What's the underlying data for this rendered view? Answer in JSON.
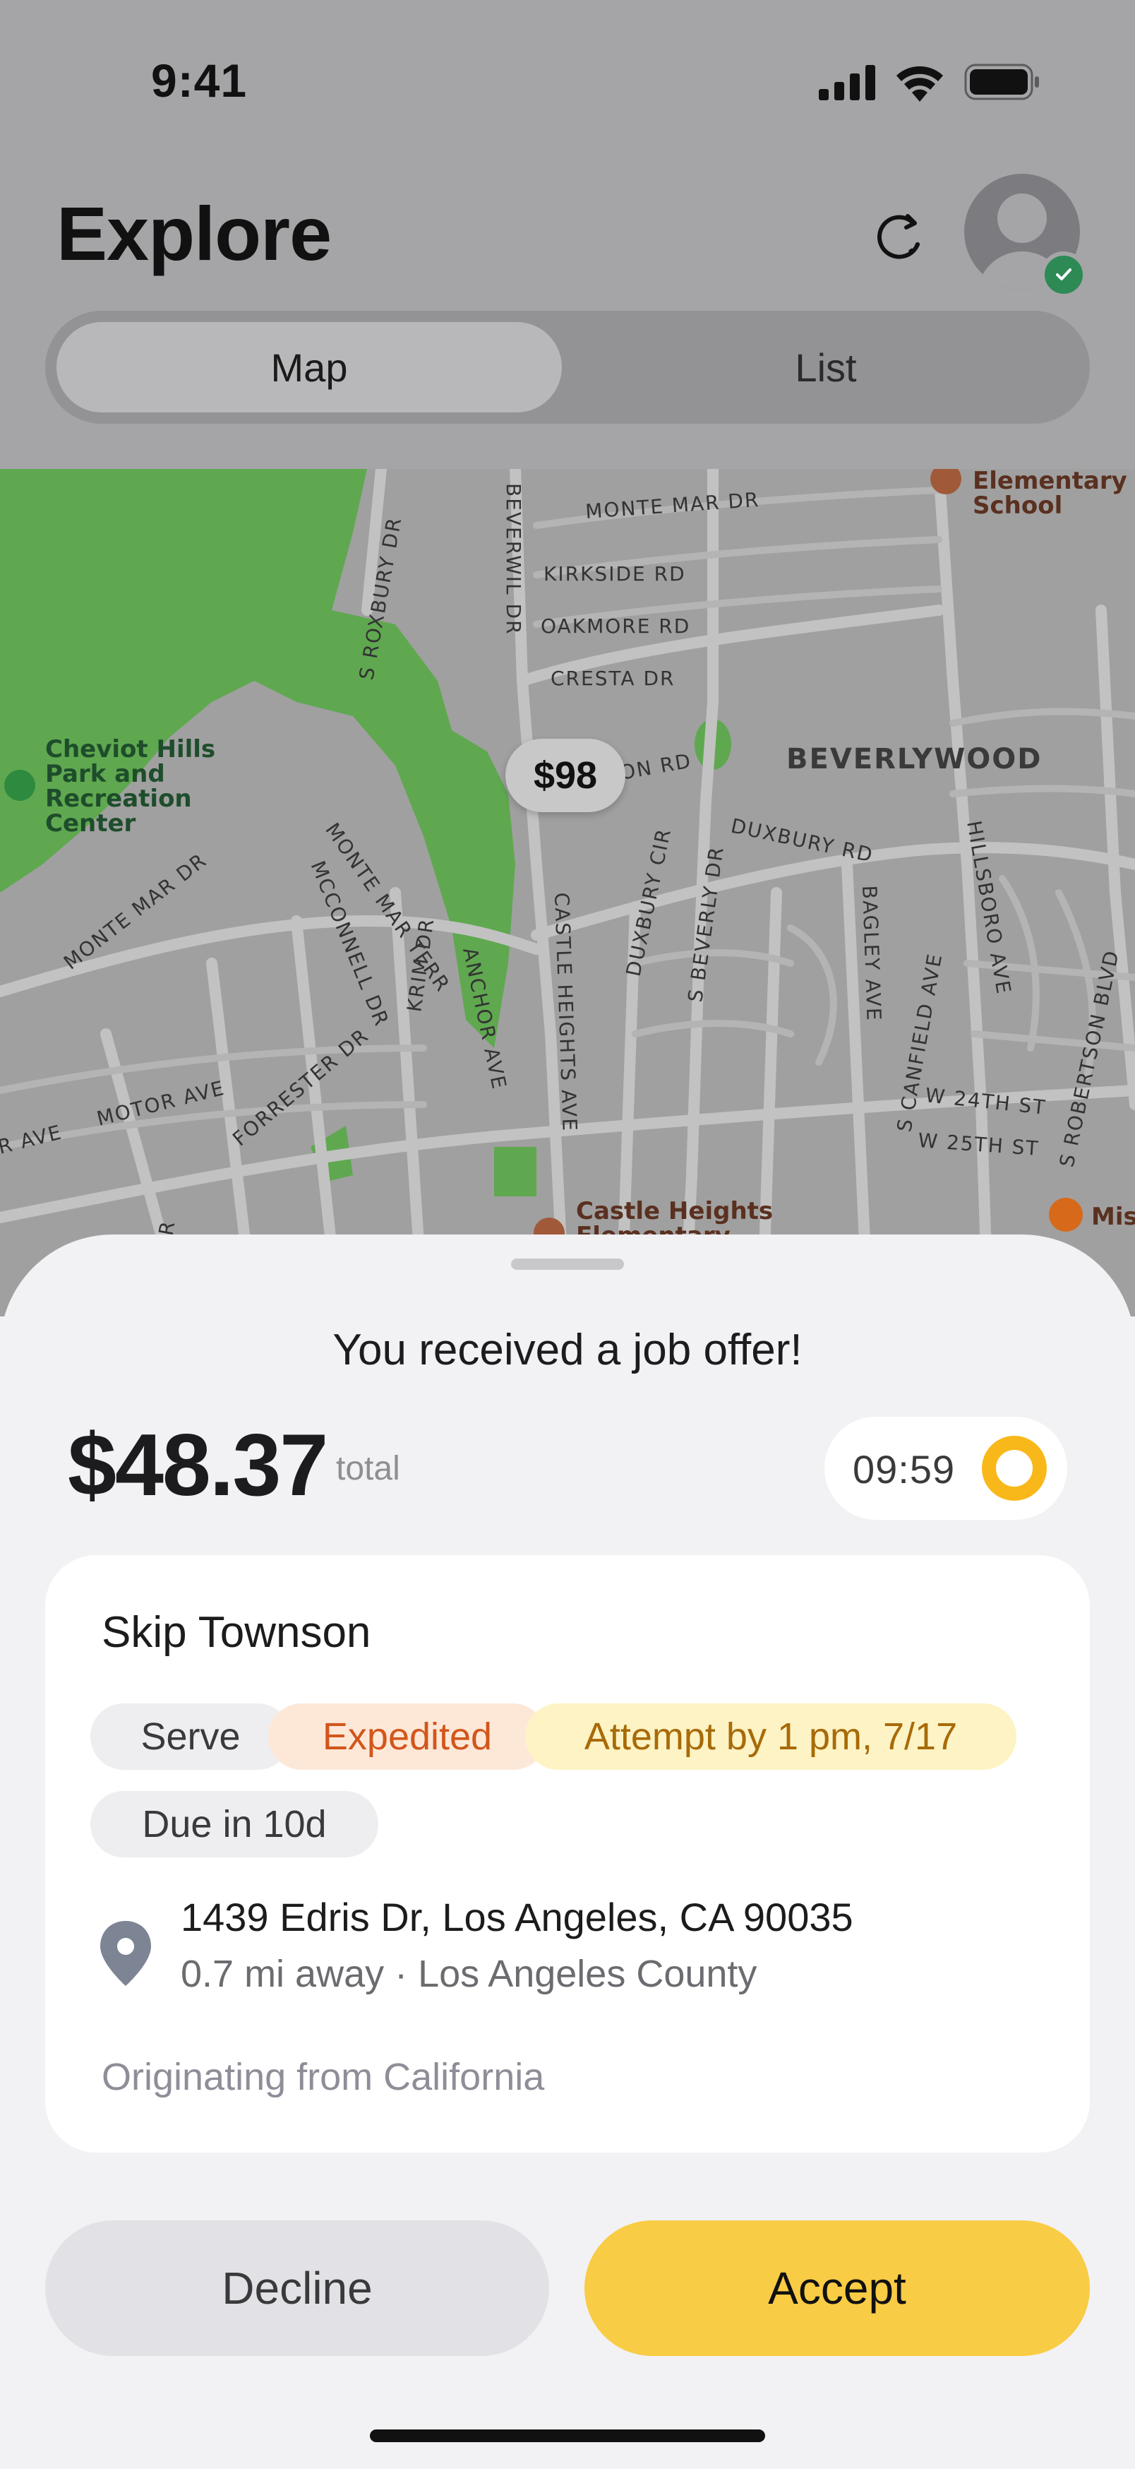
{
  "status_bar": {
    "time": "9:41"
  },
  "header": {
    "title": "Explore",
    "segments": {
      "map": "Map",
      "list": "List"
    },
    "active_segment": "Map",
    "history_icon": "history-icon",
    "avatar_status": "verified"
  },
  "map": {
    "pin_price": "$98",
    "streets": {
      "monte_mar": "MONTE MAR DR",
      "kirkside": "KIRKSIDE RD",
      "oakmore": "OAKMORE RD",
      "cresta": "CRESTA DR",
      "beverwil": "BEVERWIL DR",
      "roxbury": "S ROXBURY DR",
      "duxbury_rd": "DUXBURY RD",
      "on_rd": "ON RD",
      "monte_mar_2": "MONTE MAR DR",
      "monte_mar_terr": "MONTE MAR TERR",
      "mcconnell": "MCCONNELL DR",
      "anchor": "ANCHOR AVE",
      "krim": "KRIM DR",
      "castle_heights": "CASTLE HEIGHTS AVE",
      "duxbury_cir": "DUXBURY CIR",
      "s_beverly": "S BEVERLY DR",
      "bagley": "BAGLEY AVE",
      "hillsboro": "HILLSBORO AVE",
      "canfield": "S CANFIELD AVE",
      "robertson": "S ROBERTSON BLVD",
      "w24th": "W 24TH ST",
      "w25th": "W 25TH ST",
      "motor": "MOTOR AVE",
      "forrester": "FORRESTER DR",
      "r_ave": "R AVE",
      "dr": "DR"
    },
    "places": {
      "park_line1": "Cheviot Hills",
      "park_line2": "Park and",
      "park_line3": "Recreation",
      "park_line4": "Center",
      "school_line1": "Elementary",
      "school_line2": "School",
      "castle_line1": "Castle Heights",
      "castle_line2": "Elementary",
      "beverlywood": "BEVERLYWOOD",
      "mis": "Mis"
    }
  },
  "offer": {
    "title": "You received a job offer!",
    "amount": "$48.37",
    "amount_suffix": "total",
    "timer": "09:59",
    "client_name": "Skip Townson",
    "tags": {
      "serve": "Serve",
      "expedited": "Expedited",
      "attempt": "Attempt by 1 pm, 7/17",
      "due": "Due in 10d"
    },
    "address": "1439 Edris Dr, Los Angeles, CA 90035",
    "distance": "0.7 mi away · Los Angeles County",
    "origin": "Originating from California"
  },
  "actions": {
    "decline": "Decline",
    "accept": "Accept"
  },
  "colors": {
    "accent": "#f9cc45",
    "verified": "#2e8a55",
    "park": "#5fa850",
    "expedited": "#d2561b",
    "attempt": "#a86a08"
  }
}
